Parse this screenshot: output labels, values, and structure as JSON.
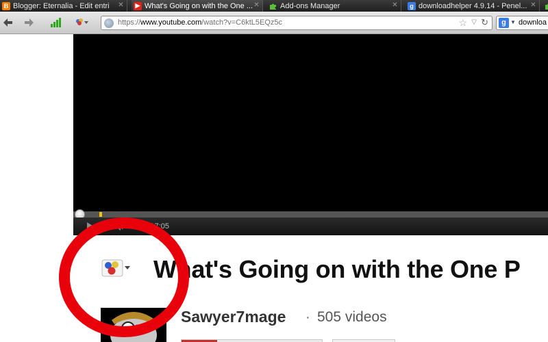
{
  "browser": {
    "tabs": [
      {
        "title": "Blogger: Eternalia - Edit entri",
        "favicon": "blogger-icon",
        "active": false
      },
      {
        "title": "What's Going on with the One ...",
        "favicon": "youtube-icon",
        "active": true
      },
      {
        "title": "Add-ons Manager",
        "favicon": "puzzle-icon",
        "active": false
      },
      {
        "title": "downloadhelper 4.9.14 - Penel...",
        "favicon": "google-icon",
        "active": false
      }
    ],
    "address": {
      "prefix": "https://",
      "host": "www.youtube.com",
      "path": "/watch?v=C6ktL5EQz5c"
    },
    "search": {
      "engine_letter": "g",
      "value": "downloa"
    }
  },
  "player": {
    "time": "0:00 / 7:05",
    "progress_fraction": 0.0
  },
  "video": {
    "title": "What's Going on with the One P",
    "channel": "Sawyer7mage",
    "separator": "·",
    "video_count": "505 videos"
  },
  "colors": {
    "annotation": "#e8000b",
    "youtube_red": "#c4302b",
    "player_bg": "#000000"
  }
}
